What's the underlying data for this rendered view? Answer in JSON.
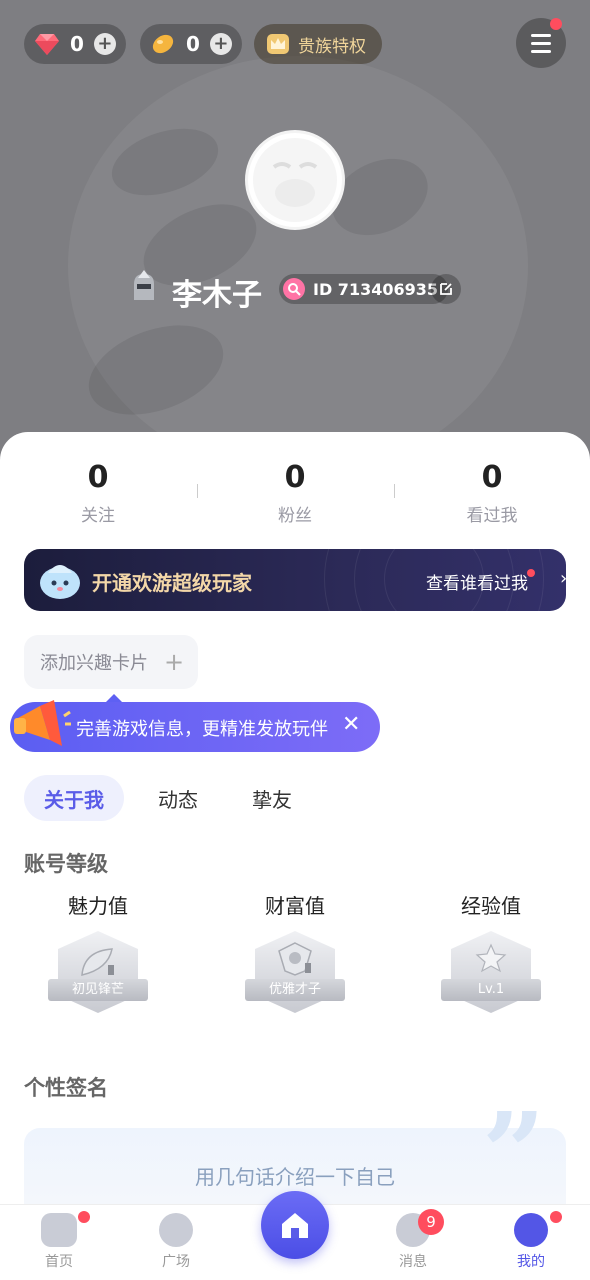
{
  "header": {
    "diamond_count": "0",
    "bean_count": "0",
    "noble_label": "贵族特权",
    "username": "李木子",
    "user_id": "ID 713406935"
  },
  "stats": [
    {
      "value": "0",
      "label": "关注"
    },
    {
      "value": "0",
      "label": "粉丝"
    },
    {
      "value": "0",
      "label": "看过我"
    }
  ],
  "vip_banner": {
    "title": "开通欢游超级玩家",
    "link": "查看谁看过我"
  },
  "interest_card": {
    "label": "添加兴趣卡片"
  },
  "tip": {
    "text": "完善游戏信息，更精准发放玩伴"
  },
  "tabs": [
    {
      "label": "关于我",
      "active": true
    },
    {
      "label": "动态",
      "active": false
    },
    {
      "label": "挚友",
      "active": false
    }
  ],
  "account_level": {
    "title": "账号等级",
    "items": [
      {
        "label": "魅力值",
        "badge": "初见锋芒"
      },
      {
        "label": "财富值",
        "badge": "优雅才子"
      },
      {
        "label": "经验值",
        "badge": "Lv.1"
      }
    ]
  },
  "signature": {
    "title": "个性签名",
    "placeholder": "用几句话介绍一下自己"
  },
  "bottom_nav": [
    {
      "label": "首页"
    },
    {
      "label": "广场"
    },
    {
      "label": "消息",
      "badge": "9"
    },
    {
      "label": "我的"
    }
  ],
  "colors": {
    "accent": "#5356e6",
    "red_dot": "#ff4d5e",
    "vip_gold": "#f3d7a8"
  }
}
